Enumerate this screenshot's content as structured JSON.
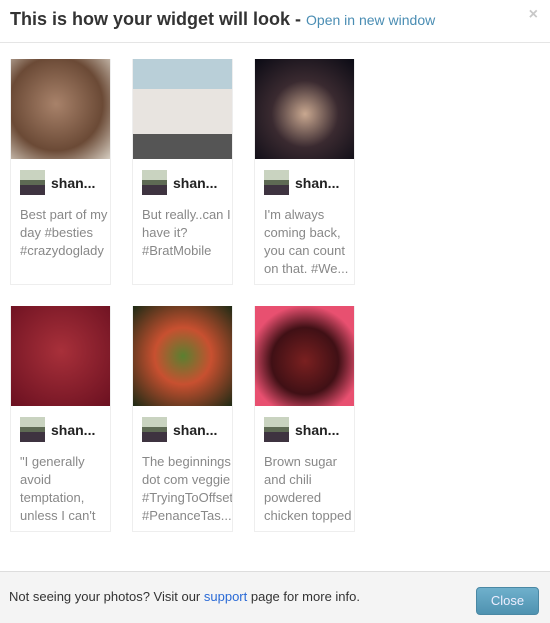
{
  "header": {
    "title": "This is how your widget will look -",
    "open_link": "Open in new window",
    "close_icon": "×"
  },
  "posts": [
    {
      "user": "shan...",
      "caption": "Best part of my day #besties #crazydoglady",
      "photo": "dog"
    },
    {
      "user": "shan...",
      "caption": "But really..can I have it? #BratMobile",
      "photo": "ice-cream-truck"
    },
    {
      "user": "shan...",
      "caption": "I'm always coming back, you can count on that. #We...",
      "photo": "couple"
    },
    {
      "user": "shan...",
      "caption": "\"I generally avoid temptation, unless I can't resist it.\" #BarWallWisdom",
      "photo": "temptation-sign"
    },
    {
      "user": "shan...",
      "caption": "The beginnings dot com veggie #TryingToOffset #PenanceTas...",
      "photo": "veggies"
    },
    {
      "user": "shan...",
      "caption": "Brown sugar and chili powdered chicken topped with",
      "photo": "chicken"
    }
  ],
  "footer": {
    "text_before": "Not seeing your photos? Visit our ",
    "link": "support",
    "text_after": " page for more info.",
    "close_button": "Close"
  }
}
